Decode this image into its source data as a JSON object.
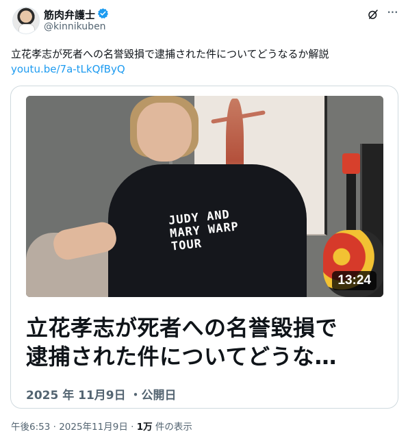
{
  "user": {
    "display_name": "筋肉弁護士",
    "handle": "@kinnikuben",
    "verified": true
  },
  "icons": {
    "verified": "verified-badge-icon",
    "grok": "grok-icon",
    "more": "more-options-icon"
  },
  "tweet": {
    "text": "立花孝志が死者への名誉毀損で逮捕された件についてどうなるか解説",
    "link": "youtu.be/7a-tLkQfByQ"
  },
  "card": {
    "duration": "13:24",
    "shirt_text": "JUDY AND MARY WARP TOUR",
    "title_line1": "立花孝志が死者への名誉毀損で",
    "title_line2": "逮捕された件についてどうな…",
    "meta": "2025 年 11月9日 ・公開日"
  },
  "footer": {
    "time": "午後6:53 · 2025年11月9日 · ",
    "views": "1万",
    "views_label": " 件の表示"
  },
  "colors": {
    "link": "#1d9bf0",
    "verified": "#1d9bf0",
    "secondary_text": "#536471"
  }
}
